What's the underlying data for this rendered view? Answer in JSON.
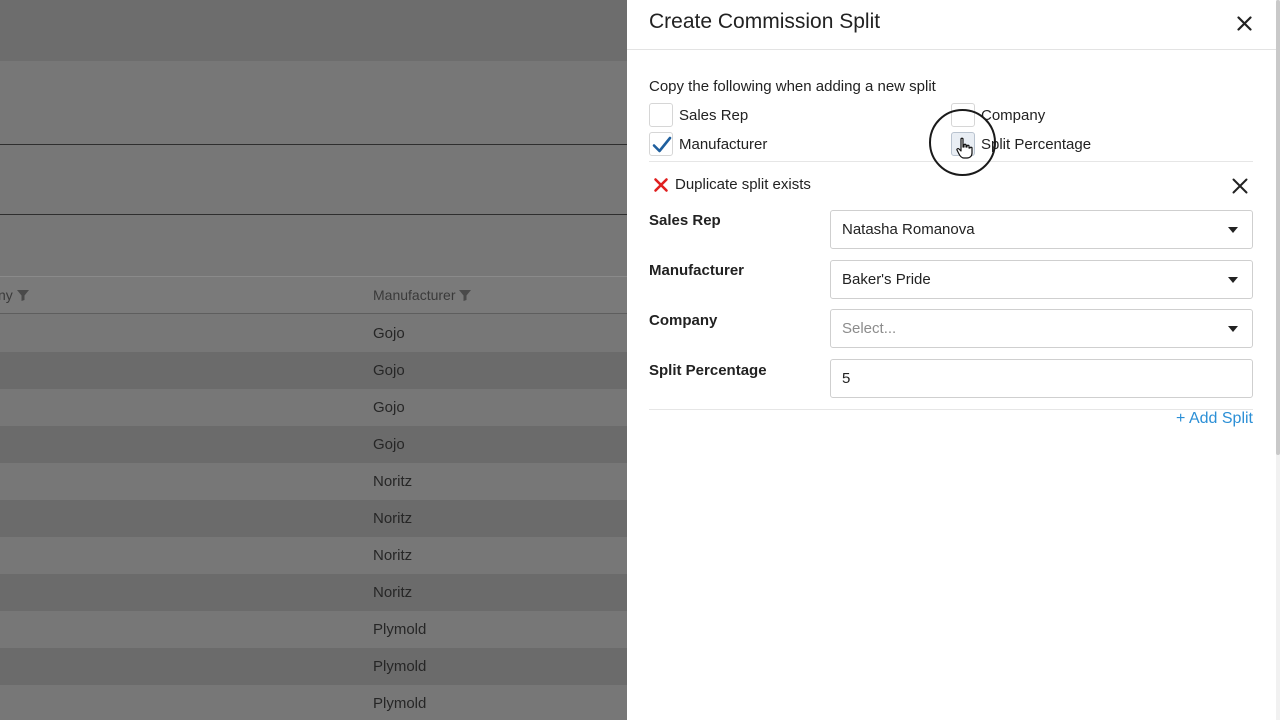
{
  "background_table": {
    "columns": [
      {
        "label": "ny",
        "filter_icon": "filter-icon"
      },
      {
        "label": "Manufacturer",
        "filter_icon": "filter-icon"
      }
    ],
    "rows": [
      "Gojo",
      "Gojo",
      "Gojo",
      "Gojo",
      "Noritz",
      "Noritz",
      "Noritz",
      "Noritz",
      "Plymold",
      "Plymold",
      "Plymold"
    ]
  },
  "drawer": {
    "title": "Create Commission Split",
    "close_icon": "close-icon",
    "copy_prompt": "Copy the following when adding a new split",
    "copy_options": [
      {
        "label": "Sales Rep",
        "checked": false
      },
      {
        "label": "Company",
        "checked": false
      },
      {
        "label": "Manufacturer",
        "checked": true
      },
      {
        "label": "Split Percentage",
        "checked": false
      }
    ],
    "split": {
      "error_icon": "error-x-icon",
      "error_message": "Duplicate split exists",
      "remove_icon": "close-icon",
      "fields": {
        "sales_rep": {
          "label": "Sales Rep",
          "value": "Natasha Romanova"
        },
        "manufacturer": {
          "label": "Manufacturer",
          "value": "Baker's Pride"
        },
        "company": {
          "label": "Company",
          "placeholder": "Select..."
        },
        "split_percentage": {
          "label": "Split Percentage",
          "value": "5"
        }
      }
    },
    "add_split_label": "+ Add Split"
  },
  "colors": {
    "accent_link": "#2b8fd6",
    "check_blue": "#1f5f9e",
    "error_red": "#e02020"
  }
}
